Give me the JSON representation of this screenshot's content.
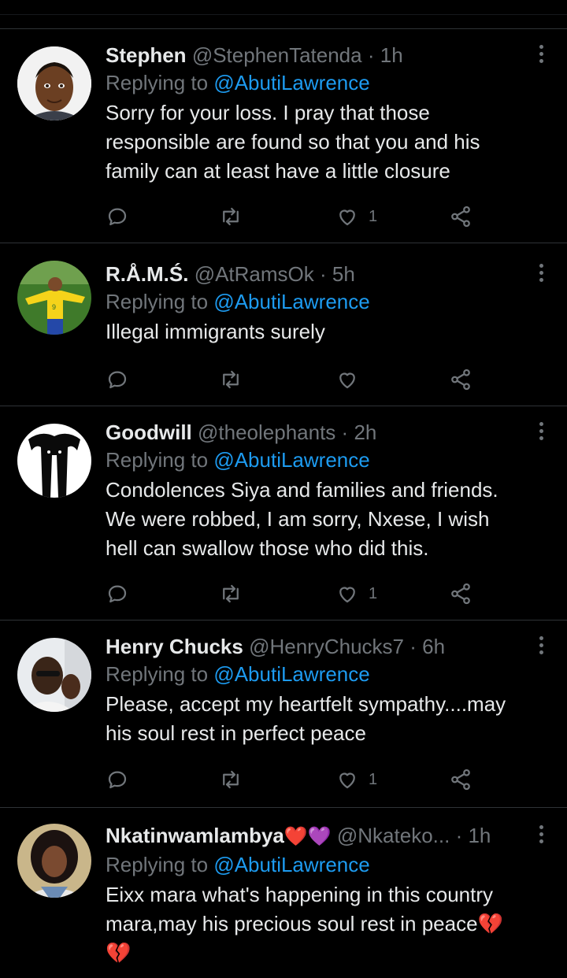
{
  "replying_label": "Replying to",
  "replies": [
    {
      "name": "Stephen",
      "handle": "@StephenTatenda",
      "separator": "·",
      "time": "1h",
      "mention": "@AbutiLawrence",
      "lines": [
        "Sorry for your loss. I pray that those",
        "responsible are found so that you and his",
        "family can at least have a little closure"
      ],
      "like_count": "1"
    },
    {
      "name": "R.Å.M.Ś.",
      "handle": "@AtRamsOk",
      "separator": "·",
      "time": "5h",
      "mention": "@AbutiLawrence",
      "lines": [
        "Illegal immigrants surely"
      ],
      "like_count": ""
    },
    {
      "name": "Goodwill",
      "handle": "@theolephants",
      "separator": "·",
      "time": "2h",
      "mention": "@AbutiLawrence",
      "lines": [
        "Condolences Siya and families and friends.",
        "We were robbed, I am sorry, Nxese, I wish",
        "hell can swallow those who did this."
      ],
      "like_count": "1"
    },
    {
      "name": "Henry Chucks",
      "handle": "@HenryChucks7",
      "separator": "·",
      "time": "6h",
      "mention": "@AbutiLawrence",
      "lines": [
        "Please, accept my heartfelt sympathy....may",
        "his soul rest in perfect peace"
      ],
      "like_count": "1"
    },
    {
      "name": "Nkatinwamlambya",
      "name_emoji": "❤️💜",
      "handle": "@Nkateko...",
      "separator": "·",
      "time": "1h",
      "mention": "@AbutiLawrence",
      "lines": [
        "Eixx mara what's happening  in this country",
        "mara,may his precious  soul rest in peace💔",
        "💔"
      ],
      "like_count": ""
    }
  ],
  "colors": {
    "background": "#000000",
    "divider": "#2f3336",
    "primary_text": "#e7e9ea",
    "secondary_text": "#71767b",
    "link": "#1d9bf0"
  },
  "icons": [
    "reply-icon",
    "retweet-icon",
    "like-icon",
    "share-icon",
    "more-icon"
  ]
}
